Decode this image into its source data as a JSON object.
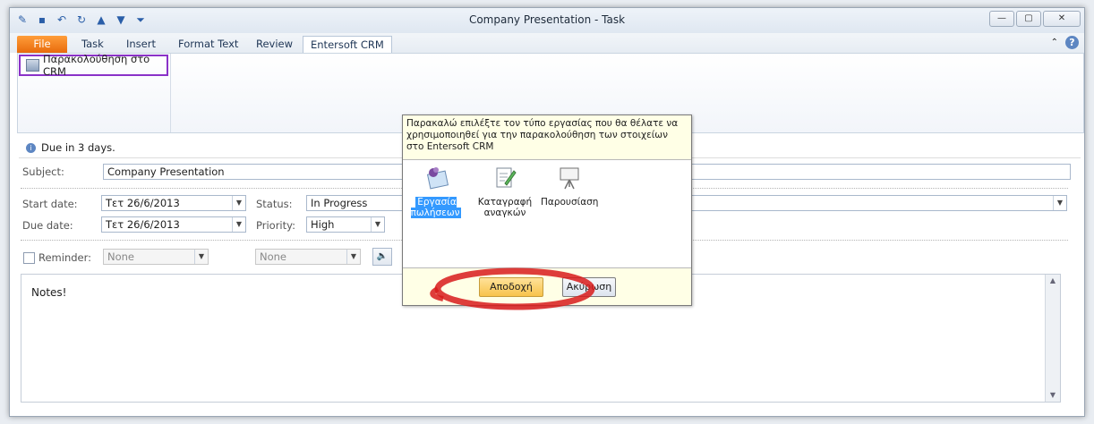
{
  "window": {
    "title": "Company Presentation  -  Task"
  },
  "ribbon_tabs": [
    "File",
    "Task",
    "Insert",
    "Format Text",
    "Review",
    "Entersoft CRM"
  ],
  "ribbon": {
    "track_button": "Παρακολούθηση στο CRM"
  },
  "form": {
    "due_notice": "Due in 3 days.",
    "subject_label": "Subject:",
    "subject_value": "Company Presentation",
    "start_label": "Start date:",
    "start_value": "Τετ 26/6/2013",
    "due_label": "Due date:",
    "due_value": "Τετ 26/6/2013",
    "status_label": "Status:",
    "status_value": "In Progress",
    "priority_label": "Priority:",
    "priority_value": "High",
    "reminder_label": "Reminder:",
    "reminder_date": "None",
    "reminder_time": "None",
    "notes": "Notes!"
  },
  "dialog": {
    "prompt": "Παρακαλώ επιλέξτε τον τύπο εργασίας που θα θέλατε να χρησιμοποιηθεί για την παρακολούθηση των στοιχείων στο Entersoft CRM",
    "options": [
      {
        "label": "Εργασία πωλήσεων",
        "selected": true,
        "icon": "pushpin-note-icon"
      },
      {
        "label": "Καταγραφή αναγκών",
        "selected": false,
        "icon": "document-pencil-icon"
      },
      {
        "label": "Παρουσίαση",
        "selected": false,
        "icon": "presentation-board-icon"
      }
    ],
    "ok_button": "Αποδοχή",
    "cancel_button": "Ακύρωση"
  },
  "colors": {
    "accent": "#3399ff",
    "file_tab": "#e86b0c",
    "highlight_box": "#8a32c8",
    "annotation_ring": "#d81b1b"
  }
}
